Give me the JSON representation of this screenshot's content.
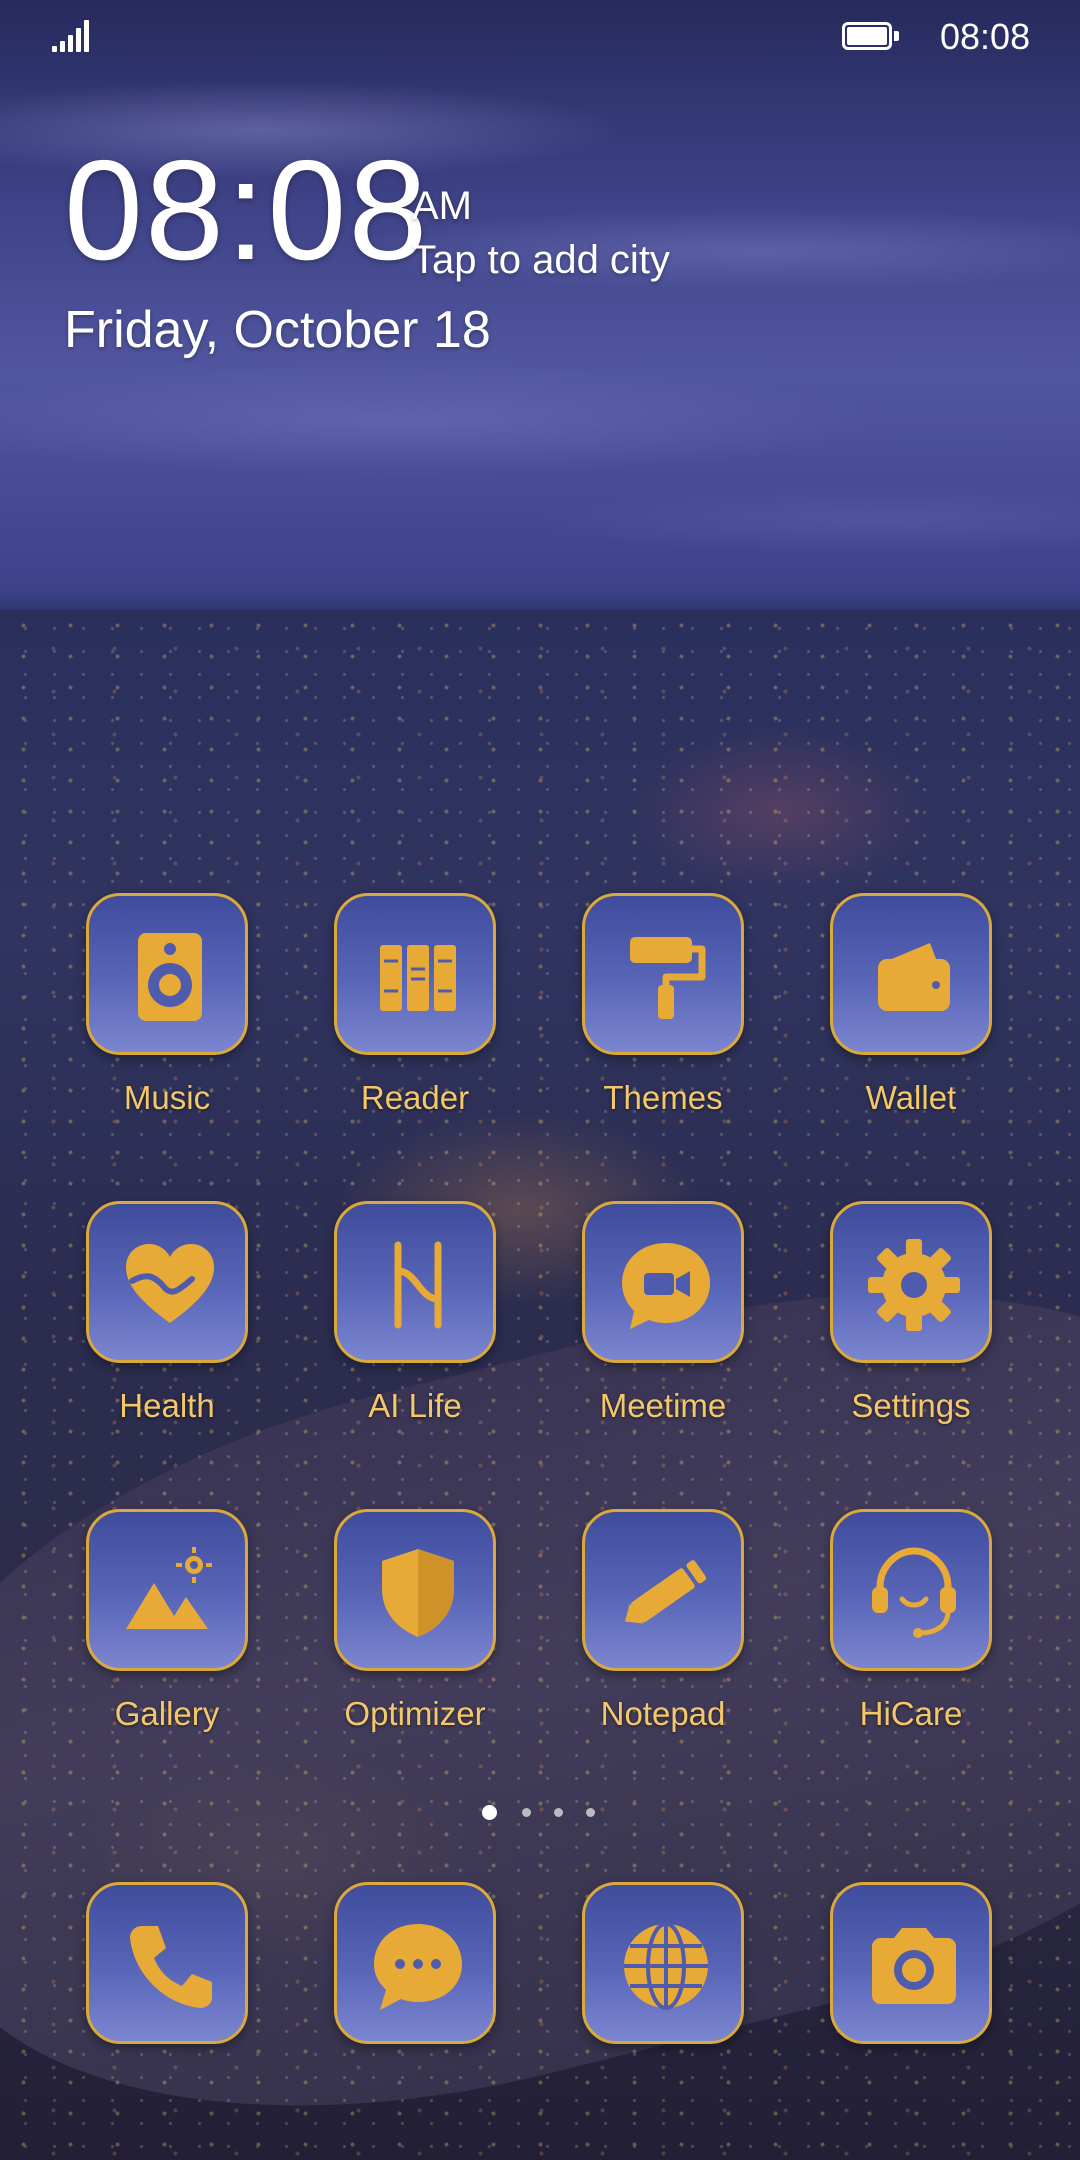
{
  "status_bar": {
    "time": "08:08",
    "signal_icon": "signal-icon",
    "battery_icon": "battery-icon"
  },
  "clock_widget": {
    "time": "08:08",
    "ampm": "AM",
    "city_hint": "Tap to add city",
    "date": "Friday, October 18"
  },
  "apps": [
    {
      "label": "Music",
      "icon": "music-speaker-icon"
    },
    {
      "label": "Reader",
      "icon": "books-icon"
    },
    {
      "label": "Themes",
      "icon": "paint-roller-icon"
    },
    {
      "label": "Wallet",
      "icon": "wallet-icon"
    },
    {
      "label": "Health",
      "icon": "heart-icon"
    },
    {
      "label": "AI Life",
      "icon": "ai-life-logo-icon"
    },
    {
      "label": "Meetime",
      "icon": "video-chat-icon"
    },
    {
      "label": "Settings",
      "icon": "gear-icon"
    },
    {
      "label": "Gallery",
      "icon": "mountain-sun-icon"
    },
    {
      "label": "Optimizer",
      "icon": "shield-icon"
    },
    {
      "label": "Notepad",
      "icon": "pencil-icon"
    },
    {
      "label": "HiCare",
      "icon": "headset-icon"
    }
  ],
  "page_indicator": {
    "pages": 4,
    "current": 1
  },
  "dock": [
    {
      "icon": "phone-icon"
    },
    {
      "icon": "message-bubble-icon"
    },
    {
      "icon": "globe-icon"
    },
    {
      "icon": "camera-icon"
    }
  ],
  "colors": {
    "accent_gold": "#e8aa36",
    "tile_blue": "#4a56a8",
    "label_gold": "#f4c86a"
  }
}
